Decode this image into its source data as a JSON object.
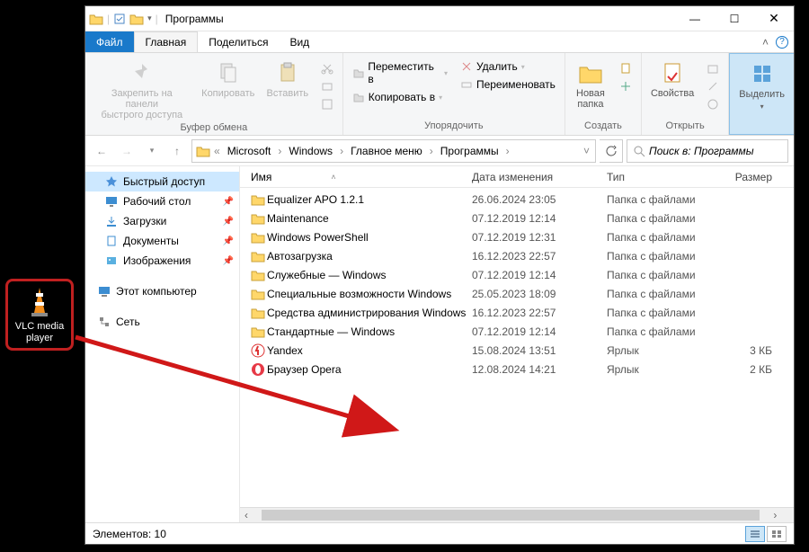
{
  "desktop": {
    "icon_label": "VLC media player"
  },
  "titlebar": {
    "title": "Программы",
    "minimize": "—",
    "maximize": "☐",
    "close": "✕"
  },
  "tabs": {
    "file": "Файл",
    "home": "Главная",
    "share": "Поделиться",
    "view": "Вид"
  },
  "ribbon": {
    "clipboard": {
      "pin": "Закрепить на панели\nбыстрого доступа",
      "copy": "Копировать",
      "paste": "Вставить",
      "label": "Буфер обмена"
    },
    "organize": {
      "move": "Переместить в",
      "copy_to": "Копировать в",
      "delete": "Удалить",
      "rename": "Переименовать",
      "label": "Упорядочить"
    },
    "new": {
      "folder": "Новая\nпапка",
      "label": "Создать"
    },
    "open": {
      "props": "Свойства",
      "label": "Открыть"
    },
    "select": {
      "all": "Выделить",
      "label": ""
    }
  },
  "breadcrumb": {
    "segs": [
      "Microsoft",
      "Windows",
      "Главное меню",
      "Программы"
    ]
  },
  "search": {
    "placeholder": "Поиск в: Программы"
  },
  "sidebar": {
    "quick": "Быстрый доступ",
    "desktop": "Рабочий стол",
    "downloads": "Загрузки",
    "documents": "Документы",
    "pictures": "Изображения",
    "thispc": "Этот компьютер",
    "network": "Сеть"
  },
  "columns": {
    "name": "Имя",
    "date": "Дата изменения",
    "type": "Тип",
    "size": "Размер"
  },
  "files": [
    {
      "icon": "folder",
      "name": "Equalizer APO 1.2.1",
      "date": "26.06.2024 23:05",
      "type": "Папка с файлами",
      "size": ""
    },
    {
      "icon": "folder",
      "name": "Maintenance",
      "date": "07.12.2019 12:14",
      "type": "Папка с файлами",
      "size": ""
    },
    {
      "icon": "folder",
      "name": "Windows PowerShell",
      "date": "07.12.2019 12:31",
      "type": "Папка с файлами",
      "size": ""
    },
    {
      "icon": "folder",
      "name": "Автозагрузка",
      "date": "16.12.2023 22:57",
      "type": "Папка с файлами",
      "size": ""
    },
    {
      "icon": "folder",
      "name": "Служебные — Windows",
      "date": "07.12.2019 12:14",
      "type": "Папка с файлами",
      "size": ""
    },
    {
      "icon": "folder",
      "name": "Специальные возможности Windows",
      "date": "25.05.2023 18:09",
      "type": "Папка с файлами",
      "size": ""
    },
    {
      "icon": "folder",
      "name": "Средства администрирования Windows",
      "date": "16.12.2023 22:57",
      "type": "Папка с файлами",
      "size": ""
    },
    {
      "icon": "folder",
      "name": "Стандартные — Windows",
      "date": "07.12.2019 12:14",
      "type": "Папка с файлами",
      "size": ""
    },
    {
      "icon": "yandex",
      "name": "Yandex",
      "date": "15.08.2024 13:51",
      "type": "Ярлык",
      "size": "3 КБ"
    },
    {
      "icon": "opera",
      "name": "Браузер Opera",
      "date": "12.08.2024 14:21",
      "type": "Ярлык",
      "size": "2 КБ"
    }
  ],
  "statusbar": {
    "count": "Элементов: 10"
  }
}
